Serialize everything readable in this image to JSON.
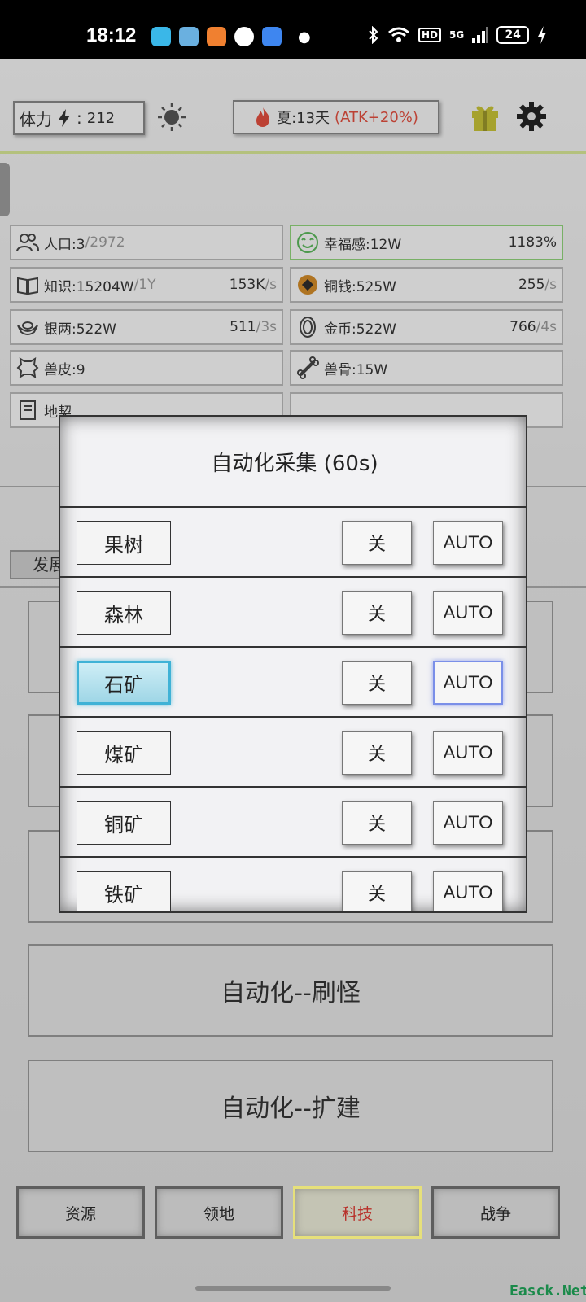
{
  "status_bar": {
    "time": "18:12",
    "network": "HD",
    "signal": "5G",
    "battery": "24"
  },
  "header": {
    "stamina_label": "体力",
    "stamina_value": "212",
    "season_text": "夏:13天",
    "season_bonus": "(ATK+20%)"
  },
  "stats": {
    "population": {
      "label": "人口:3",
      "cap": "/2972"
    },
    "happiness": {
      "label": "幸福感:12W",
      "rate": "1183%"
    },
    "knowledge": {
      "label": "知识:15204W",
      "cap": "/1Y",
      "rate": "153K",
      "unit": "/s"
    },
    "copper_coin": {
      "label": "铜钱:525W",
      "rate": "255",
      "unit": "/s"
    },
    "silver": {
      "label": "银两:522W",
      "rate": "511",
      "unit": "/3s"
    },
    "gold": {
      "label": "金币:522W",
      "rate": "766",
      "unit": "/4s"
    },
    "hide": {
      "label": "兽皮:9"
    },
    "bone": {
      "label": "兽骨:15W"
    },
    "land": {
      "label": "地契"
    },
    "other": {
      "label": ""
    }
  },
  "background": {
    "dev_tab": "发展",
    "button_hunt": "自动化--刷怪",
    "button_expand": "自动化--扩建"
  },
  "modal": {
    "title": "自动化采集 (60s)",
    "rows": [
      {
        "name": "果树",
        "off": "关",
        "auto": "AUTO"
      },
      {
        "name": "森林",
        "off": "关",
        "auto": "AUTO"
      },
      {
        "name": "石矿",
        "off": "关",
        "auto": "AUTO"
      },
      {
        "name": "煤矿",
        "off": "关",
        "auto": "AUTO"
      },
      {
        "name": "铜矿",
        "off": "关",
        "auto": "AUTO"
      },
      {
        "name": "铁矿",
        "off": "关",
        "auto": "AUTO"
      }
    ],
    "selected_row": "石矿"
  },
  "nav": {
    "resources": "资源",
    "territory": "领地",
    "tech": "科技",
    "war": "战争",
    "active": "科技"
  },
  "watermark": "Easck.Net",
  "colors": {
    "accent_red": "#d23c2c",
    "selected_cyan": "#3fb2d6",
    "active_nav": "#e6e07a",
    "happiness_green": "#7fc46a"
  }
}
